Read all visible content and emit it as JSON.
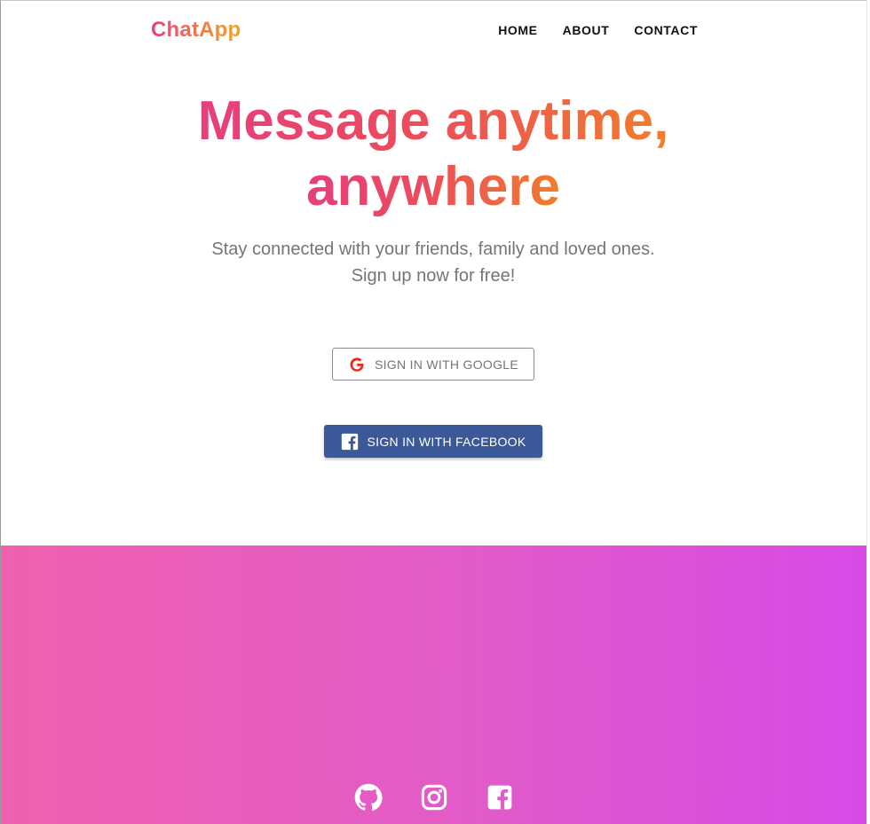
{
  "header": {
    "brand": "ChatApp",
    "nav": [
      "HOME",
      "ABOUT",
      "CONTACT"
    ]
  },
  "hero": {
    "title_line1": "Message anytime,",
    "title_line2": "anywhere",
    "subtitle_line1": "Stay connected with your friends, family and loved ones.",
    "subtitle_line2": "Sign up now for free!"
  },
  "auth": {
    "google_label": "SIGN IN WITH GOOGLE",
    "facebook_label": "SIGN IN WITH FACEBOOK"
  },
  "footer": {
    "social_icons": [
      "github-icon",
      "instagram-icon",
      "facebook-icon"
    ]
  },
  "colors": {
    "facebook_blue": "#3b5998",
    "brand_pink": "#ea3f80",
    "brand_orange": "#f07d2b",
    "footer_left": "#ef60ae",
    "footer_right": "#d84ae6"
  }
}
